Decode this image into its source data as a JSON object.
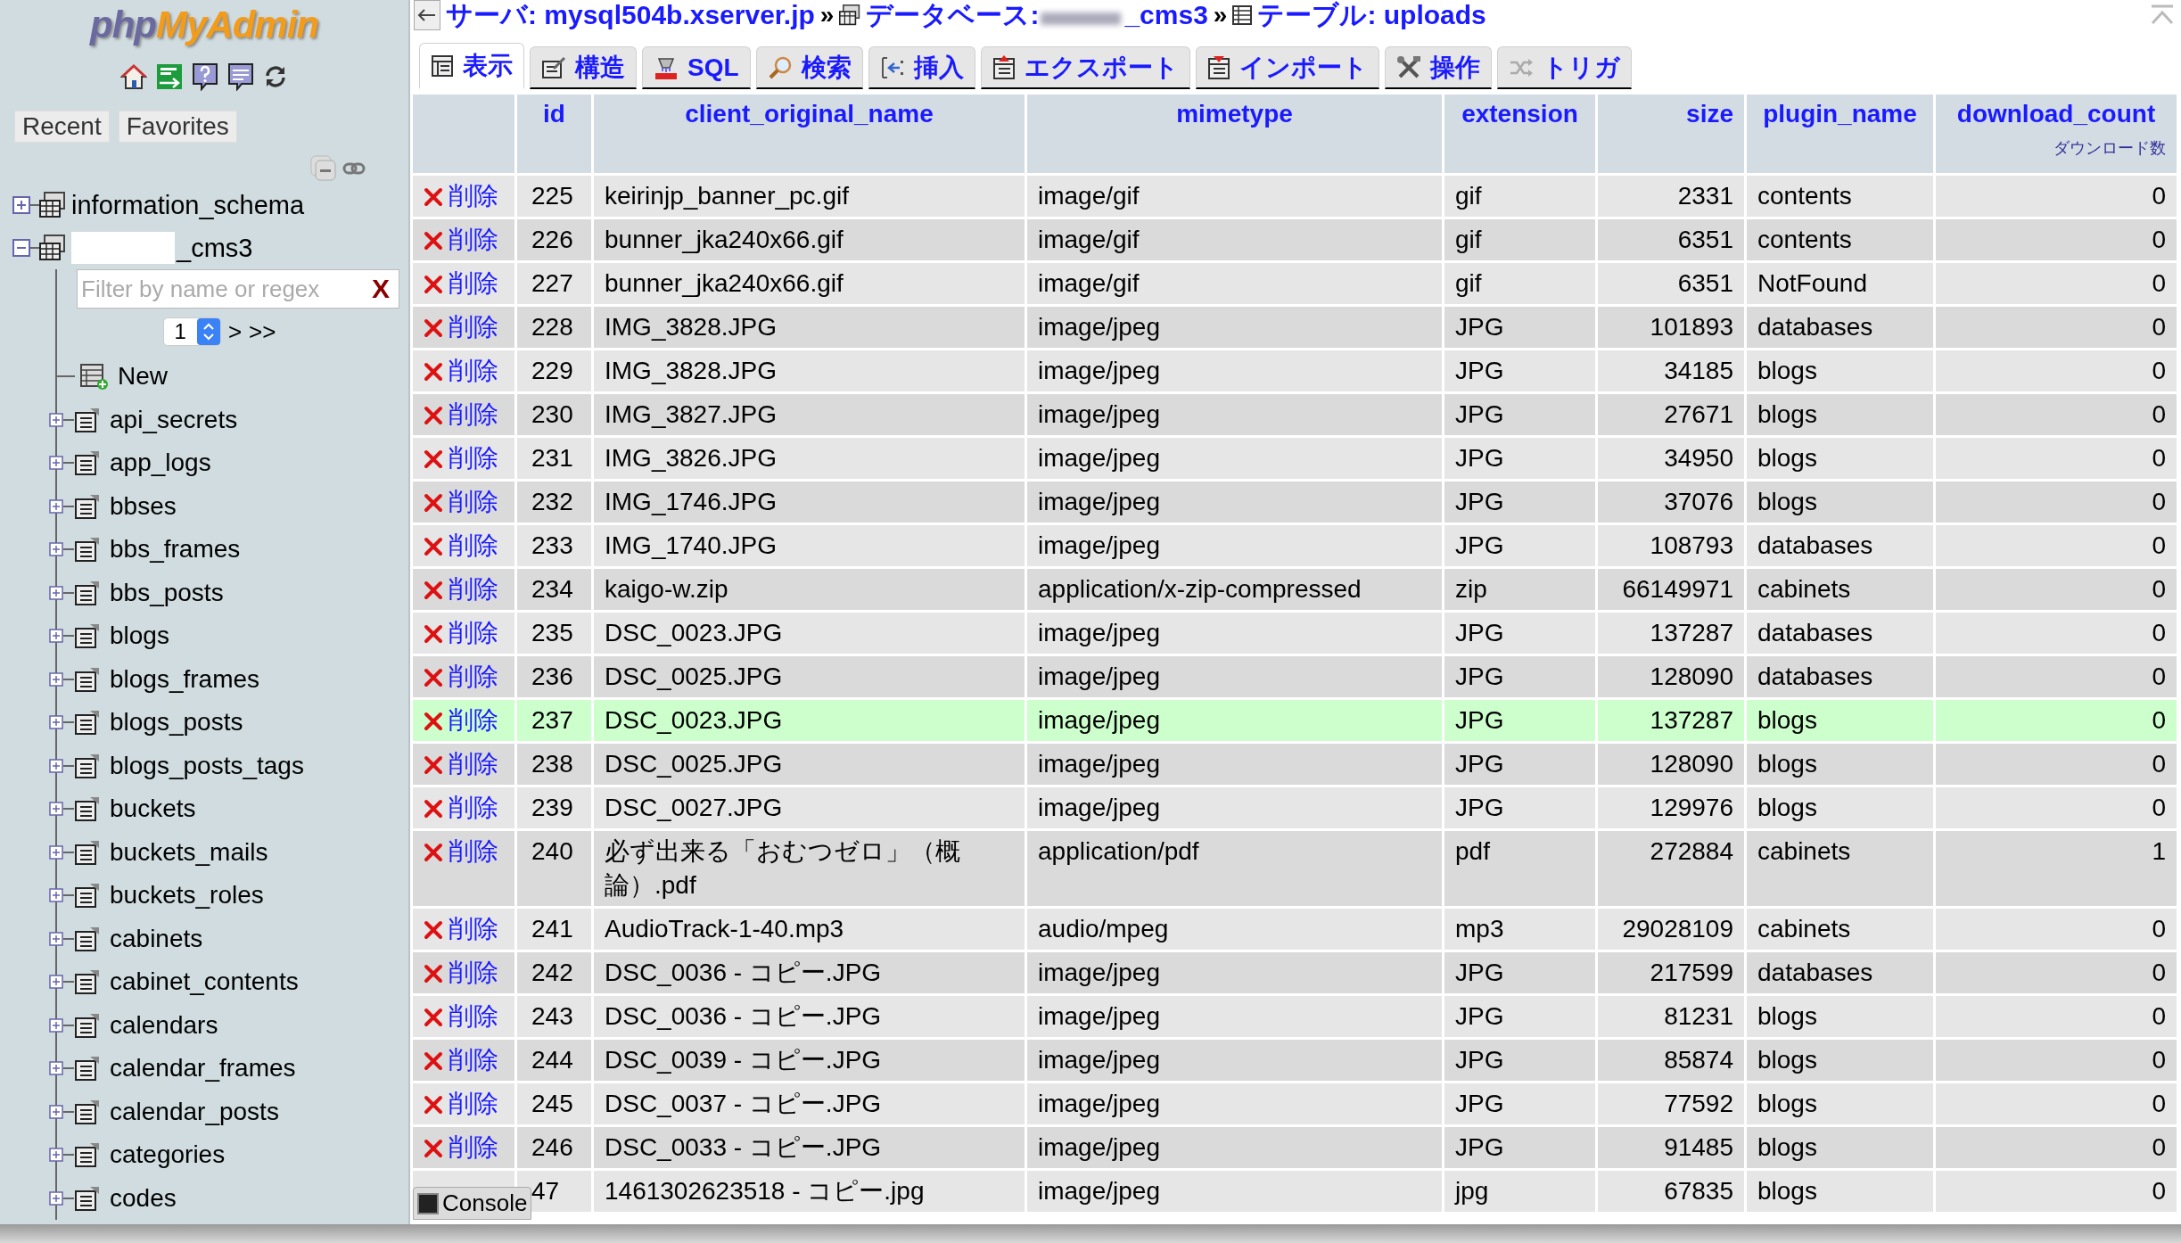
{
  "sidebar": {
    "logo": {
      "php": "php",
      "rest": "MyAdmin"
    },
    "tabs": [
      "Recent",
      "Favorites"
    ],
    "databases": [
      {
        "name": "information_schema",
        "expanded": false
      },
      {
        "name": "_cms3",
        "expanded": true,
        "redacted": true,
        "filter": {
          "placeholder": "Filter by name or regex",
          "clear": "X"
        },
        "page": "1",
        "nav": [
          ">",
          ">>"
        ],
        "new": "New",
        "tables": [
          "api_secrets",
          "app_logs",
          "bbses",
          "bbs_frames",
          "bbs_posts",
          "blogs",
          "blogs_frames",
          "blogs_posts",
          "blogs_posts_tags",
          "buckets",
          "buckets_mails",
          "buckets_roles",
          "cabinets",
          "cabinet_contents",
          "calendars",
          "calendar_frames",
          "calendar_posts",
          "categories",
          "codes"
        ]
      }
    ]
  },
  "breadcrumb": [
    {
      "kind": "server",
      "label": "サーバ: mysql504b.xserver.jp"
    },
    {
      "kind": "database",
      "separator": "»",
      "label": "データベース: ",
      "value": "_cms3",
      "redacted": true
    },
    {
      "kind": "table",
      "separator": "»",
      "label": "テーブル: uploads"
    }
  ],
  "tabs": [
    {
      "kind": "browse",
      "label": "表示",
      "selected": true
    },
    {
      "kind": "structure",
      "label": "構造",
      "selected": false
    },
    {
      "kind": "sql",
      "label": "SQL",
      "selected": false
    },
    {
      "kind": "search",
      "label": "検索",
      "selected": false
    },
    {
      "kind": "insert",
      "label": "挿入",
      "selected": false
    },
    {
      "kind": "export",
      "label": "エクスポート",
      "selected": false
    },
    {
      "kind": "import",
      "label": "インポート",
      "selected": false
    },
    {
      "kind": "operations",
      "label": "操作",
      "selected": false
    },
    {
      "kind": "triggers",
      "label": "トリガ",
      "selected": false
    }
  ],
  "table": {
    "columns": [
      {
        "name": "id"
      },
      {
        "name": "client_original_name"
      },
      {
        "name": "mimetype"
      },
      {
        "name": "extension"
      },
      {
        "name": "size"
      },
      {
        "name": "plugin_name"
      },
      {
        "name": "download_count",
        "comment": "ダウンロード数"
      }
    ],
    "rows": [
      {
        "delete": "削除",
        "cells": [
          "225",
          "keirinjp_banner_pc.gif",
          "image/gif",
          "gif",
          "2331",
          "contents",
          "0"
        ],
        "marked": false
      },
      {
        "delete": "削除",
        "cells": [
          "226",
          "bunner_jka240x66.gif",
          "image/gif",
          "gif",
          "6351",
          "contents",
          "0"
        ],
        "marked": false
      },
      {
        "delete": "削除",
        "cells": [
          "227",
          "bunner_jka240x66.gif",
          "image/gif",
          "gif",
          "6351",
          "NotFound",
          "0"
        ],
        "marked": false
      },
      {
        "delete": "削除",
        "cells": [
          "228",
          "IMG_3828.JPG",
          "image/jpeg",
          "JPG",
          "101893",
          "databases",
          "0"
        ],
        "marked": false
      },
      {
        "delete": "削除",
        "cells": [
          "229",
          "IMG_3828.JPG",
          "image/jpeg",
          "JPG",
          "34185",
          "blogs",
          "0"
        ],
        "marked": false
      },
      {
        "delete": "削除",
        "cells": [
          "230",
          "IMG_3827.JPG",
          "image/jpeg",
          "JPG",
          "27671",
          "blogs",
          "0"
        ],
        "marked": false
      },
      {
        "delete": "削除",
        "cells": [
          "231",
          "IMG_3826.JPG",
          "image/jpeg",
          "JPG",
          "34950",
          "blogs",
          "0"
        ],
        "marked": false
      },
      {
        "delete": "削除",
        "cells": [
          "232",
          "IMG_1746.JPG",
          "image/jpeg",
          "JPG",
          "37076",
          "blogs",
          "0"
        ],
        "marked": false
      },
      {
        "delete": "削除",
        "cells": [
          "233",
          "IMG_1740.JPG",
          "image/jpeg",
          "JPG",
          "108793",
          "databases",
          "0"
        ],
        "marked": false
      },
      {
        "delete": "削除",
        "cells": [
          "234",
          "kaigo-w.zip",
          "application/x-zip-compressed",
          "zip",
          "66149971",
          "cabinets",
          "0"
        ],
        "marked": false
      },
      {
        "delete": "削除",
        "cells": [
          "235",
          "DSC_0023.JPG",
          "image/jpeg",
          "JPG",
          "137287",
          "databases",
          "0"
        ],
        "marked": false
      },
      {
        "delete": "削除",
        "cells": [
          "236",
          "DSC_0025.JPG",
          "image/jpeg",
          "JPG",
          "128090",
          "databases",
          "0"
        ],
        "marked": false
      },
      {
        "delete": "削除",
        "cells": [
          "237",
          "DSC_0023.JPG",
          "image/jpeg",
          "JPG",
          "137287",
          "blogs",
          "0"
        ],
        "marked": true
      },
      {
        "delete": "削除",
        "cells": [
          "238",
          "DSC_0025.JPG",
          "image/jpeg",
          "JPG",
          "128090",
          "blogs",
          "0"
        ],
        "marked": false
      },
      {
        "delete": "削除",
        "cells": [
          "239",
          "DSC_0027.JPG",
          "image/jpeg",
          "JPG",
          "129976",
          "blogs",
          "0"
        ],
        "marked": false
      },
      {
        "delete": "削除",
        "cells": [
          "240",
          "必ず出来る「おむつゼロ」（概論）.pdf",
          "application/pdf",
          "pdf",
          "272884",
          "cabinets",
          "1"
        ],
        "marked": false
      },
      {
        "delete": "削除",
        "cells": [
          "241",
          "AudioTrack-1-40.mp3",
          "audio/mpeg",
          "mp3",
          "29028109",
          "cabinets",
          "0"
        ],
        "marked": false
      },
      {
        "delete": "削除",
        "cells": [
          "242",
          "DSC_0036 - コピー.JPG",
          "image/jpeg",
          "JPG",
          "217599",
          "databases",
          "0"
        ],
        "marked": false
      },
      {
        "delete": "削除",
        "cells": [
          "243",
          "DSC_0036 - コピー.JPG",
          "image/jpeg",
          "JPG",
          "81231",
          "blogs",
          "0"
        ],
        "marked": false
      },
      {
        "delete": "削除",
        "cells": [
          "244",
          "DSC_0039 - コピー.JPG",
          "image/jpeg",
          "JPG",
          "85874",
          "blogs",
          "0"
        ],
        "marked": false
      },
      {
        "delete": "削除",
        "cells": [
          "245",
          "DSC_0037 - コピー.JPG",
          "image/jpeg",
          "JPG",
          "77592",
          "blogs",
          "0"
        ],
        "marked": false
      },
      {
        "delete": "削除",
        "cells": [
          "246",
          "DSC_0033 - コピー.JPG",
          "image/jpeg",
          "JPG",
          "91485",
          "blogs",
          "0"
        ],
        "marked": false
      },
      {
        "cells": [
          "47",
          "1461302623518 - コピー.jpg",
          "image/jpeg",
          "jpg",
          "67835",
          "blogs",
          "0"
        ],
        "marked": false
      }
    ]
  },
  "console": "Console"
}
